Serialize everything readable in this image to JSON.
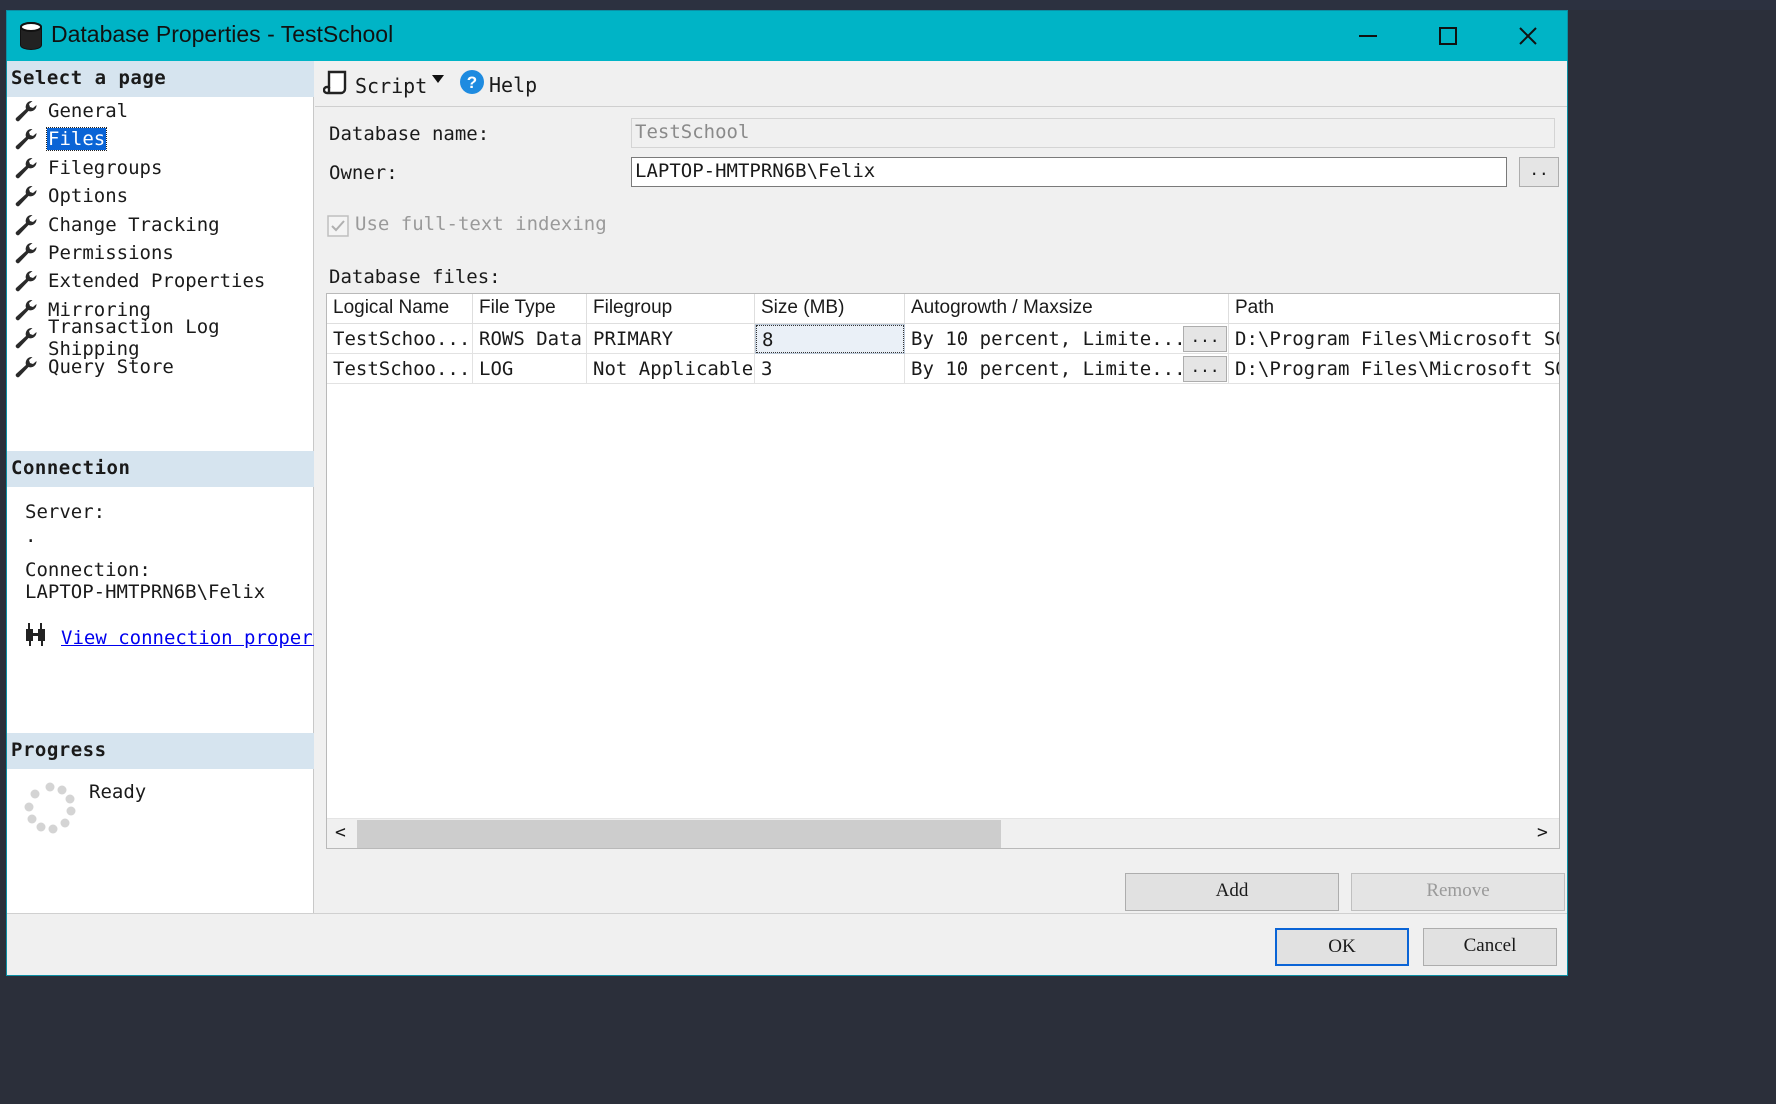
{
  "window": {
    "title": "Database Properties - TestSchool",
    "minimize_glyph": "—",
    "maximize_glyph": "☐",
    "close_glyph": "✕"
  },
  "left_panel": {
    "select_page_header": "Select a page",
    "pages": [
      {
        "label": "General",
        "selected": false
      },
      {
        "label": "Files",
        "selected": true
      },
      {
        "label": "Filegroups",
        "selected": false
      },
      {
        "label": "Options",
        "selected": false
      },
      {
        "label": "Change Tracking",
        "selected": false
      },
      {
        "label": "Permissions",
        "selected": false
      },
      {
        "label": "Extended Properties",
        "selected": false
      },
      {
        "label": "Mirroring",
        "selected": false
      },
      {
        "label": "Transaction Log Shipping",
        "selected": false
      },
      {
        "label": "Query Store",
        "selected": false
      }
    ],
    "connection_header": "Connection",
    "server_label": "Server:",
    "server_value": ".",
    "connection_label": "Connection:",
    "connection_value": "LAPTOP-HMTPRN6B\\Felix",
    "view_connection_link": "View connection properties",
    "progress_header": "Progress",
    "progress_status": "Ready"
  },
  "toolbar": {
    "script_label": "Script",
    "help_label": "Help"
  },
  "form": {
    "database_name_label": "Database name:",
    "database_name_value": "TestSchool",
    "owner_label": "Owner:",
    "owner_value": "LAPTOP-HMTPRN6B\\Felix",
    "owner_browse_label": "..",
    "fulltext_label": "Use full-text indexing",
    "fulltext_checked": true,
    "database_files_label": "Database files:"
  },
  "files_grid": {
    "columns": [
      "Logical Name",
      "File Type",
      "Filegroup",
      "Size (MB)",
      "Autogrowth / Maxsize",
      "Path"
    ],
    "rows": [
      {
        "logical_name": "TestSchoo...",
        "file_type": "ROWS Data",
        "filegroup": "PRIMARY",
        "size_mb": "8",
        "autogrowth": "By 10 percent, Limite...",
        "ellipsis": "...",
        "path": "D:\\Program Files\\Microsoft SQL"
      },
      {
        "logical_name": "TestSchoo...",
        "file_type": "LOG",
        "filegroup": "Not Applicable",
        "size_mb": "3",
        "autogrowth": "By 10 percent, Limite...",
        "ellipsis": "...",
        "path": "D:\\Program Files\\Microsoft SQL"
      }
    ],
    "scroll_left_glyph": "<",
    "scroll_right_glyph": ">"
  },
  "buttons": {
    "add": "Add",
    "remove": "Remove",
    "ok": "OK",
    "cancel": "Cancel"
  },
  "colors": {
    "titlebar": "#00b4c6",
    "section_header": "#d6e4ef",
    "selection": "#0a64d6",
    "link": "#0000ee"
  }
}
